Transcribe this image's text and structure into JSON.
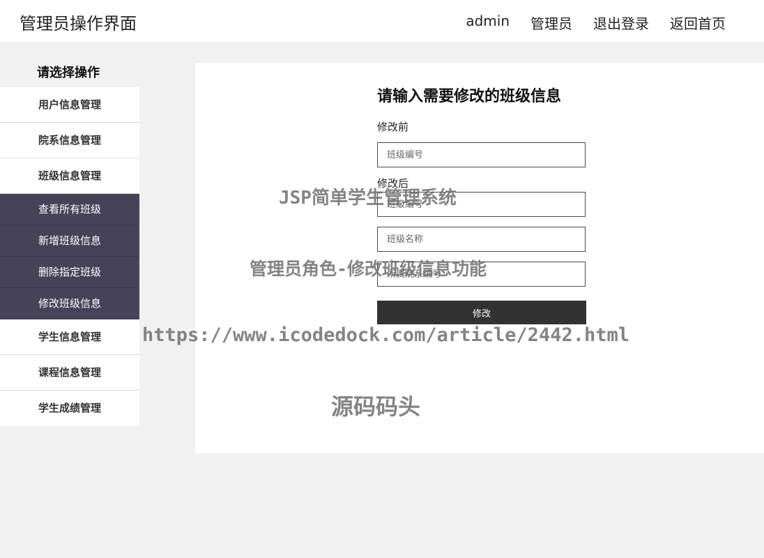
{
  "header": {
    "title": "管理员操作界面",
    "nav": [
      "admin",
      "管理员",
      "退出登录",
      "返回首页"
    ]
  },
  "sidebar": {
    "heading": "请选择操作",
    "items_before": [
      "用户信息管理",
      "院系信息管理",
      "班级信息管理"
    ],
    "subitems": [
      "查看所有班级",
      "新增班级信息",
      "删除指定班级",
      "修改班级信息"
    ],
    "items_after": [
      "学生信息管理",
      "课程信息管理",
      "学生成绩管理"
    ]
  },
  "form": {
    "title": "请输入需要修改的班级信息",
    "before_label": "修改前",
    "before_placeholder": "班级编号",
    "after_label": "修改后",
    "after_placeholders": [
      "班级编号",
      "班级名称",
      "所属院系编号"
    ],
    "submit_label": "修改"
  },
  "watermarks": [
    "JSP简单学生管理系统",
    "管理员角色-修改班级信息功能",
    "https://www.icodedock.com/article/2442.html",
    "源码码头"
  ],
  "colors": {
    "page_bg": "#f1f1f1",
    "submenu_bg": "#46425a",
    "button_bg": "#323232"
  }
}
